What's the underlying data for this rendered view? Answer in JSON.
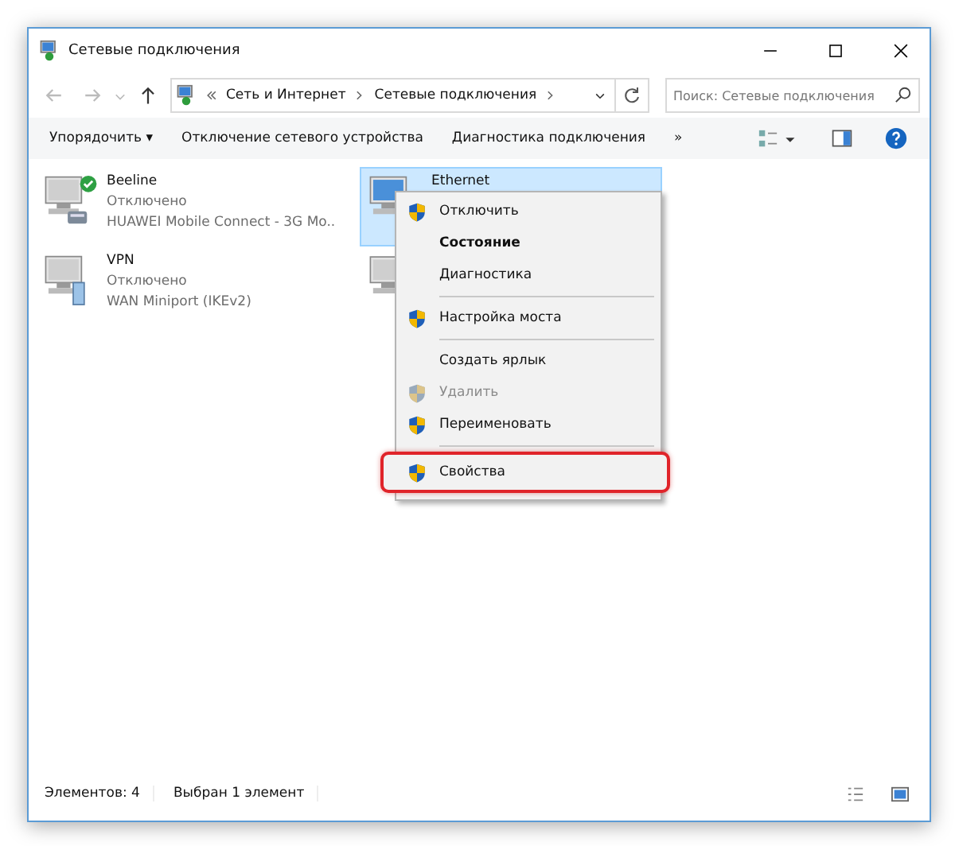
{
  "window": {
    "title": "Сетевые подключения"
  },
  "address": {
    "path": [
      "Сеть и Интернет",
      "Сетевые подключения"
    ]
  },
  "search": {
    "placeholder": "Поиск: Сетевые подключения"
  },
  "toolbar": {
    "items": [
      "Упорядочить ▾",
      "Отключение сетевого устройства",
      "Диагностика подключения",
      "»"
    ]
  },
  "connections": [
    {
      "name": "Beeline",
      "status": "Отключено",
      "device": "HUAWEI Mobile Connect - 3G Mo...",
      "connected": true,
      "selected": false,
      "kind": "modem"
    },
    {
      "name": "Ethernet",
      "selected": true,
      "connected": false,
      "kind": "wired"
    },
    {
      "name": "VPN",
      "status": "Отключено",
      "device": "WAN Miniport (IKEv2)",
      "connected": false,
      "selected": false,
      "kind": "server"
    },
    {
      "selected": false,
      "kind": "wired"
    }
  ],
  "context_menu": [
    {
      "kind": "item",
      "label": "Отключить",
      "shield": true,
      "bold": false,
      "disabled": false,
      "highlighted": false
    },
    {
      "kind": "item",
      "label": "Состояние",
      "shield": false,
      "bold": true,
      "disabled": false,
      "highlighted": false
    },
    {
      "kind": "item",
      "label": "Диагностика",
      "shield": false,
      "bold": false,
      "disabled": false,
      "highlighted": false
    },
    {
      "kind": "separator"
    },
    {
      "kind": "item",
      "label": "Настройка моста",
      "shield": true,
      "bold": false,
      "disabled": false,
      "highlighted": false
    },
    {
      "kind": "separator"
    },
    {
      "kind": "item",
      "label": "Создать ярлык",
      "shield": false,
      "bold": false,
      "disabled": false,
      "highlighted": false
    },
    {
      "kind": "item",
      "label": "Удалить",
      "shield": true,
      "bold": false,
      "disabled": true,
      "highlighted": false
    },
    {
      "kind": "item",
      "label": "Переименовать",
      "shield": true,
      "bold": false,
      "disabled": false,
      "highlighted": false
    },
    {
      "kind": "separator"
    },
    {
      "kind": "item",
      "label": "Свойства",
      "shield": true,
      "bold": false,
      "disabled": false,
      "highlighted": true
    }
  ],
  "status_bar": {
    "count": "Элементов: 4",
    "selection": "Выбран 1 элемент"
  }
}
